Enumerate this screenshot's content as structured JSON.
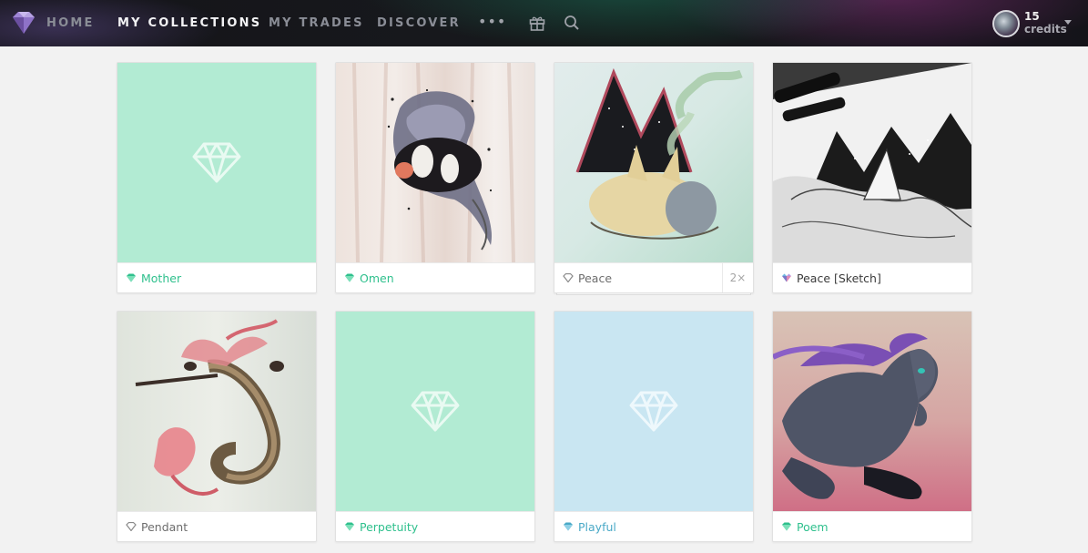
{
  "nav": {
    "home": "HOME",
    "collections": "MY COLLECTIONS",
    "trades": "MY TRADES",
    "discover": "DISCOVER",
    "more": "•••",
    "icons": [
      "gift-icon",
      "search-icon"
    ]
  },
  "account": {
    "credits_value": "15",
    "credits_label": "credits"
  },
  "colors": {
    "mint": "#b2ebd3",
    "sky": "#c9e6f2",
    "accent_green": "#2fc08d",
    "accent_blue": "#4aa9c7"
  },
  "cards": [
    {
      "title": "Mother",
      "state": "placeholder-mint",
      "gem": "green-gem"
    },
    {
      "title": "Omen",
      "state": "art-fish",
      "gem": "green-gem"
    },
    {
      "title": "Peace",
      "state": "art-fox",
      "gem": "outline-gem",
      "count": "2×"
    },
    {
      "title": "Peace [Sketch]",
      "state": "art-sketch",
      "gem": "multicolor-gem"
    },
    {
      "title": "Pendant",
      "state": "art-seadragon",
      "gem": "outline-gem"
    },
    {
      "title": "Perpetuity",
      "state": "placeholder-mint",
      "gem": "green-gem"
    },
    {
      "title": "Playful",
      "state": "placeholder-sky",
      "gem": "blue-gem"
    },
    {
      "title": "Poem",
      "state": "art-horse",
      "gem": "green-gem"
    }
  ]
}
